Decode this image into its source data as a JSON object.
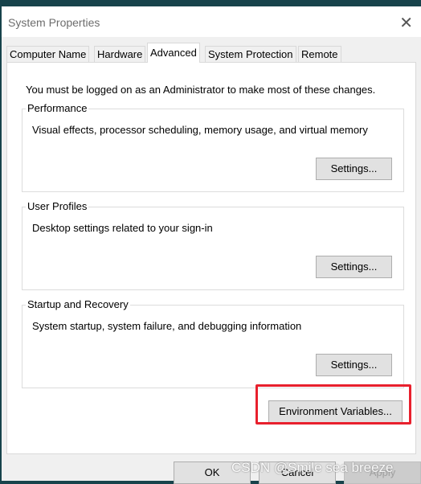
{
  "window": {
    "title": "System Properties",
    "close_icon": "close-icon"
  },
  "tabs": [
    {
      "label": "Computer Name"
    },
    {
      "label": "Hardware"
    },
    {
      "label": "Advanced",
      "active": true
    },
    {
      "label": "System Protection"
    },
    {
      "label": "Remote"
    }
  ],
  "notice": "You must be logged on as an Administrator to make most of these changes.",
  "groups": [
    {
      "title": "Performance",
      "description": "Visual effects, processor scheduling, memory usage, and virtual memory",
      "button": "Settings..."
    },
    {
      "title": "User Profiles",
      "description": "Desktop settings related to your sign-in",
      "button": "Settings..."
    },
    {
      "title": "Startup and Recovery",
      "description": "System startup, system failure, and debugging information",
      "button": "Settings..."
    }
  ],
  "env_button": "Environment Variables...",
  "highlight_color": "#e8202d",
  "footer": {
    "ok": "OK",
    "cancel": "Cancel",
    "apply": "Apply"
  },
  "watermark": "CSDN @Smile sea breeze"
}
